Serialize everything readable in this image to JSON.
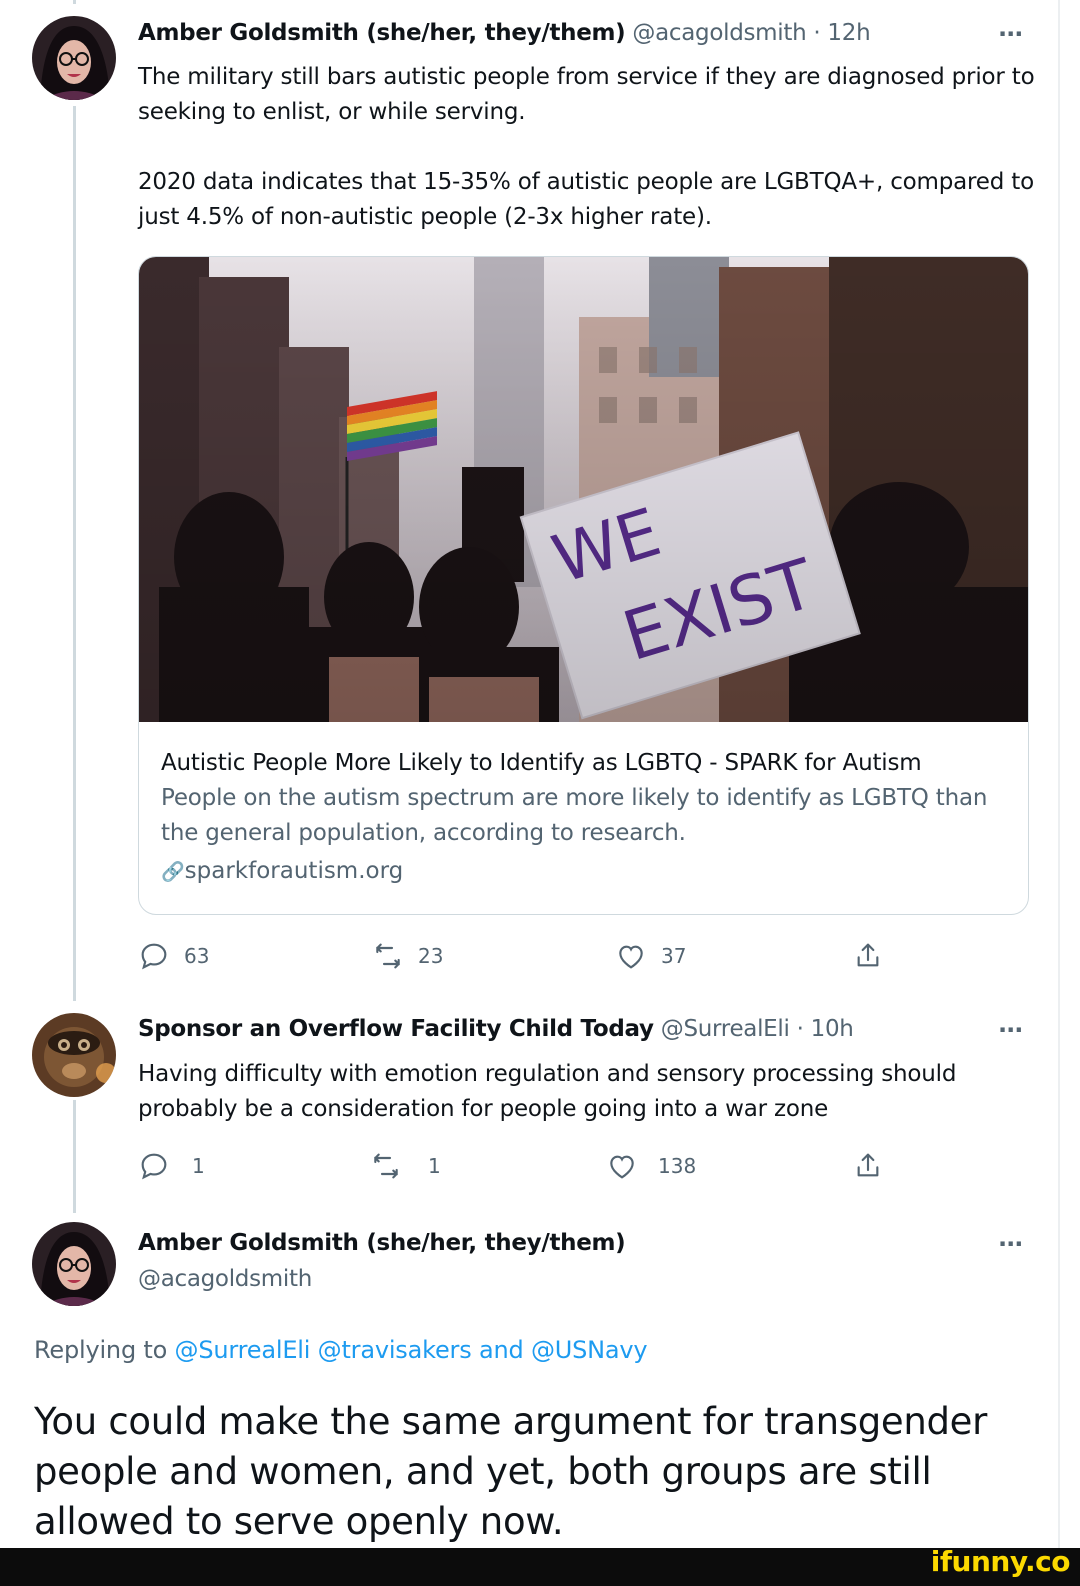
{
  "tweet1": {
    "name": "Amber Goldsmith (she/her, they/them)",
    "handle": "@acagoldsmith",
    "separator": "·",
    "time": "12h",
    "more": "···",
    "paragraph1": "The military still bars autistic people from service if they are diagnosed prior to seeking to enlist, or while serving.",
    "paragraph2": "2020 data indicates that 15-35% of autistic people are LGBTQA+, compared to just 4.5% of non-autistic people (2-3x higher rate).",
    "card": {
      "sign_line1": "WE",
      "sign_line2": "EXIST",
      "title": "Autistic People More Likely to Identify as LGBTQ - SPARK for Autism",
      "description": "People on the autism spectrum are more likely to identify as LGBTQ than the general population, according to research.",
      "link_icon": "🔗",
      "domain": "sparkforautism.org"
    },
    "actions": {
      "replies": "63",
      "retweets": "23",
      "likes": "37"
    }
  },
  "tweet2": {
    "name": "Sponsor an Overflow Facility Child Today",
    "handle": "@SurrealEli",
    "separator": "·",
    "time": "10h",
    "more": "···",
    "text": "Having difficulty with emotion regulation and sensory processing should probably be a consideration for people going into a war zone",
    "actions": {
      "replies": "1",
      "retweets": "1",
      "likes": "138"
    }
  },
  "tweet3": {
    "name": "Amber Goldsmith (she/her, they/them)",
    "handle": "@acagoldsmith",
    "more": "···",
    "replying_prefix": "Replying to",
    "mention1": "@SurrealEli",
    "mention2": "@travisakers",
    "replying_and": "and",
    "mention3": "@USNavy",
    "text": "You could make the same argument for transgender people and women, and yet, both groups are still allowed to serve openly now."
  },
  "watermark": "ifunny.co",
  "colors": {
    "text": "#0f1419",
    "secondary": "#536471",
    "link": "#1d9bf0",
    "watermark": "#fcd900",
    "sign_text": "#5a2d91"
  }
}
